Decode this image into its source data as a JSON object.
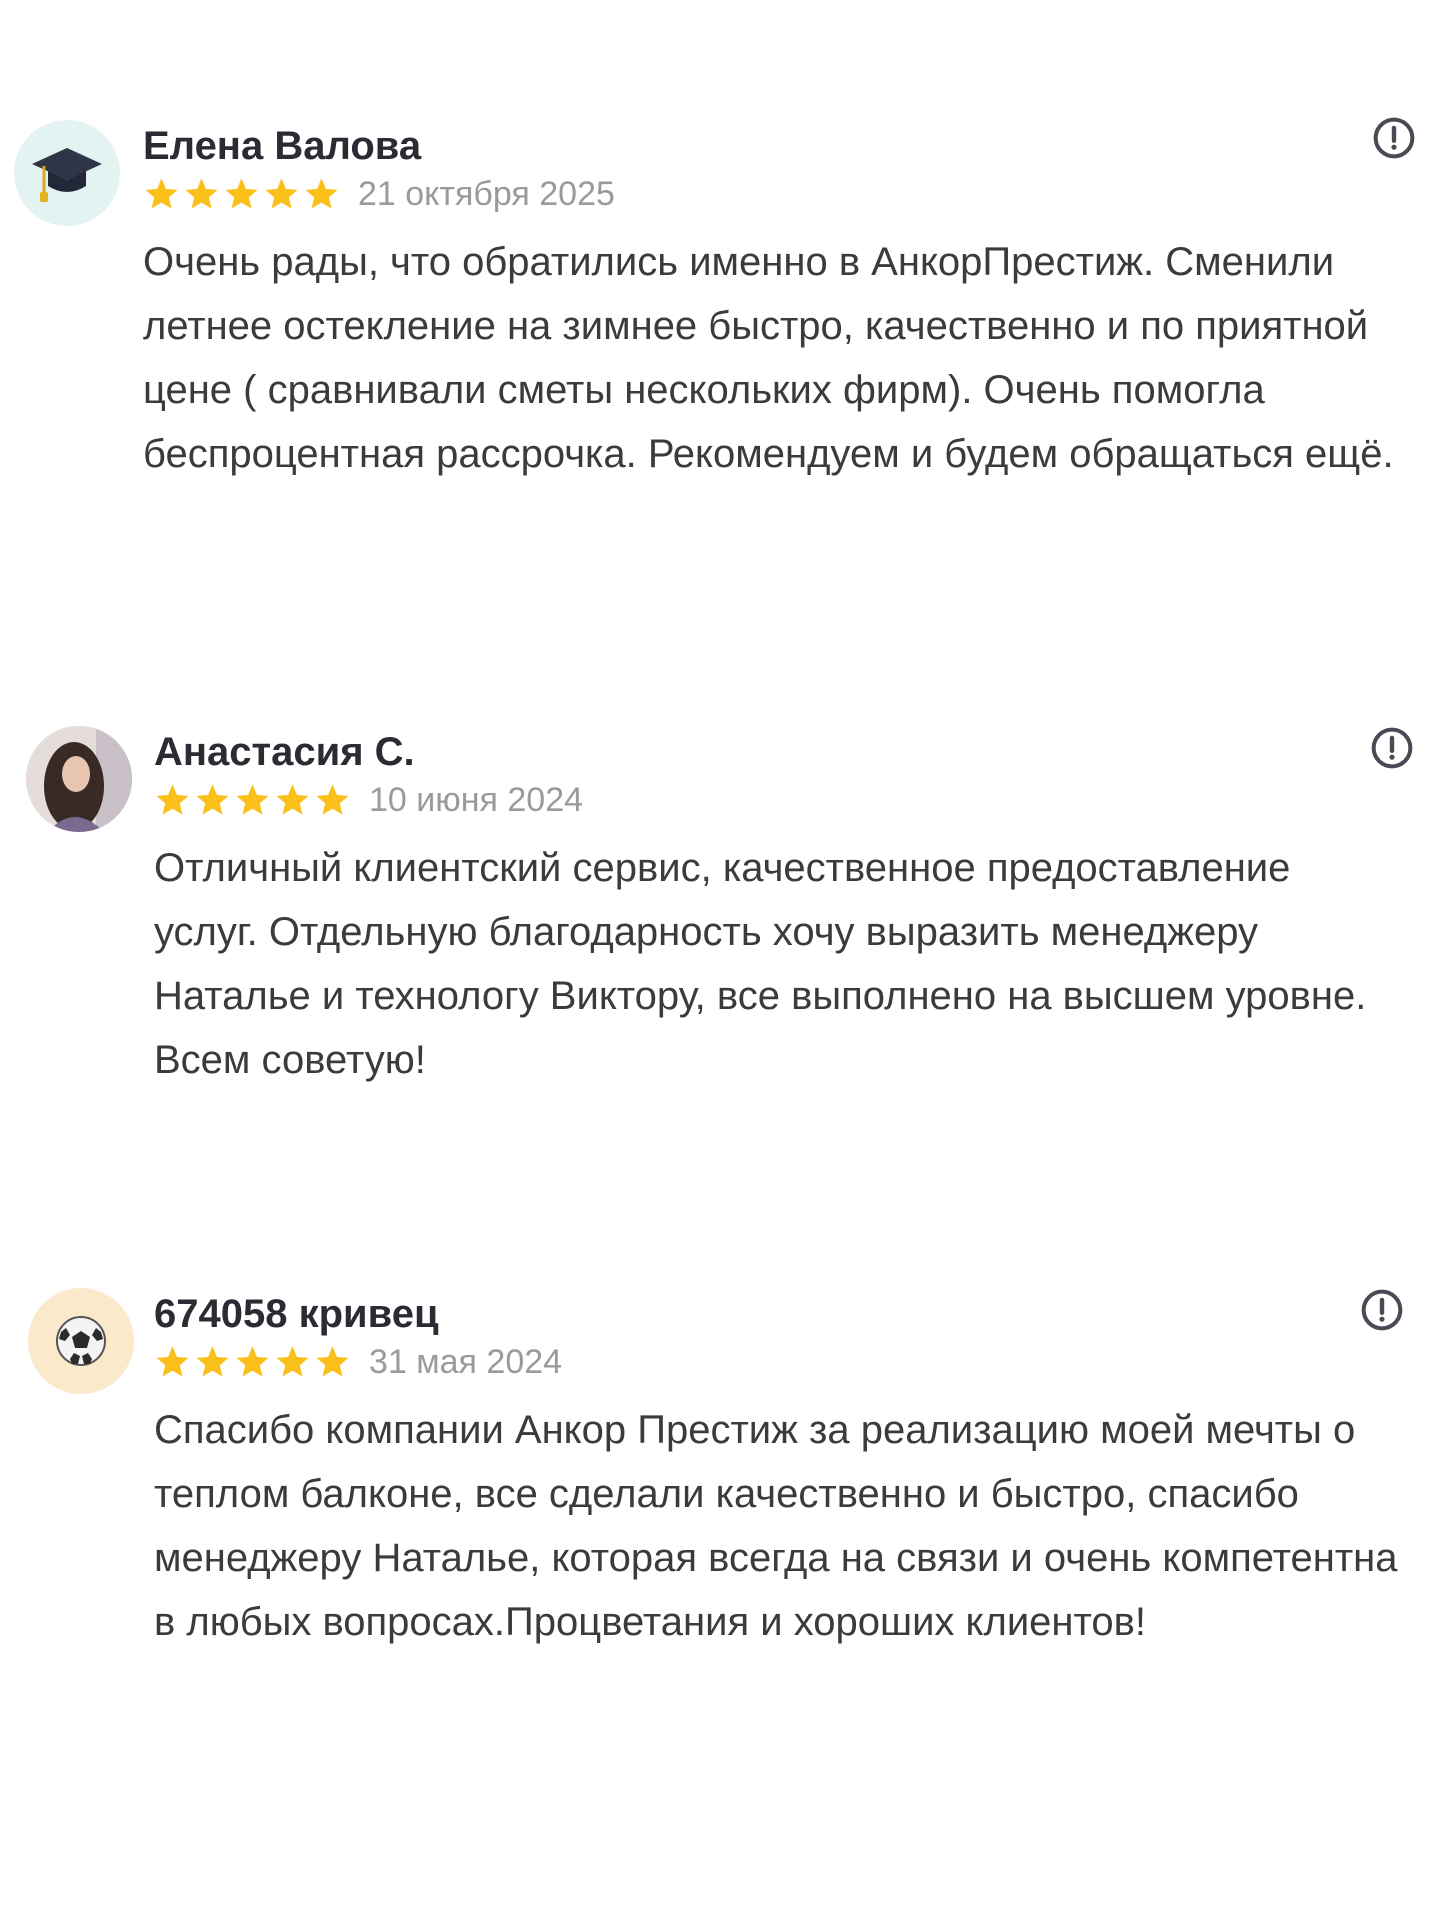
{
  "reviews": [
    {
      "author": "Елена Валова",
      "date": "21 октября 2025",
      "rating": 5,
      "text": "Очень рады, что обратились именно в АнкорПрестиж. Сменили летнее остекление на зимнее быстро, качественно и по приятной цене ( сравнивали сметы нескольких фирм). Очень помогла беспроцентная рассрочка. Рекомендуем и будем обращаться ещё.",
      "avatar_icon": "graduation-cap-icon"
    },
    {
      "author": "Анастасия С.",
      "date": "10 июня 2024",
      "rating": 5,
      "text": "Отличный клиентский сервис, качественное предоставление услуг. Отдельную благодарность хочу выразить менеджеру Наталье и технологу Виктору, все выполнено на высшем уровне. Всем советую!",
      "avatar_icon": "user-photo"
    },
    {
      "author": "674058 кривец",
      "date": "31 мая 2024",
      "rating": 5,
      "text": "Спасибо компании Анкор Престиж за реализацию моей мечты о теплом балконе, все сделали качественно и быстро, спасибо менеджеру Наталье, которая всегда на связи и очень компетентна в любых вопросах.Процветания и хороших клиентов!",
      "avatar_icon": "soccer-ball-icon"
    }
  ],
  "colors": {
    "star": "#fbbf1a",
    "date": "#9a9a9a",
    "author": "#2b2b33",
    "text": "#3b3b3b",
    "report_icon": "#4a4a55"
  }
}
